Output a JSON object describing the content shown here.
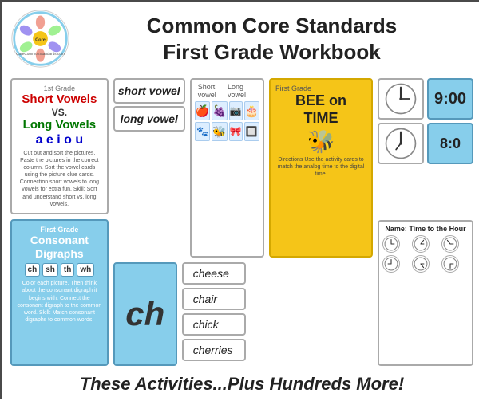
{
  "header": {
    "title_line1": "Common Core Standards",
    "title_line2": "First Grade Workbook"
  },
  "cards": {
    "short_long_vowels": {
      "grade": "1st Grade",
      "line1": "Short Vowels",
      "vs": "VS.",
      "line2": "Long Vowels",
      "vowels": "a e i o u",
      "body": "Cut out and sort the pictures. Paste the pictures in the correct column. Sort the vowel cards using the picture clue cards. Connection short vowels to long vowels for extra fun. Skill: Sort and understand short vs. long vowels."
    },
    "consonant_digraphs": {
      "grade": "First Grade",
      "title": "Consonant Digraphs",
      "digraphs": [
        "ch",
        "sh",
        "th",
        "wh"
      ],
      "body": "Color each picture. Then think about the consonant digraph it begins with. Connect the consonant digraph to the common word. Skill: Match consonant digraphs to common words."
    },
    "vowel_labels": [
      "short vowel",
      "long vowel"
    ],
    "picture_grid_header": [
      "Short vowel",
      "Long vowel"
    ],
    "bee_on_time": {
      "grade": "First Grade",
      "title_line1": "BEE on",
      "title_line2": "TIME",
      "directions": "Directions\nUse the activity cards to match the analog time to the digital time."
    },
    "ch_card": "ch",
    "word_list": [
      "cheese",
      "chair",
      "chick",
      "cherries"
    ],
    "clocks": {
      "digital_1": "9:00",
      "digital_2": "8:0"
    },
    "worksheet": {
      "title": "Time to the Hour"
    }
  },
  "footer": {
    "text": "These Activities...Plus Hundreds More!"
  }
}
